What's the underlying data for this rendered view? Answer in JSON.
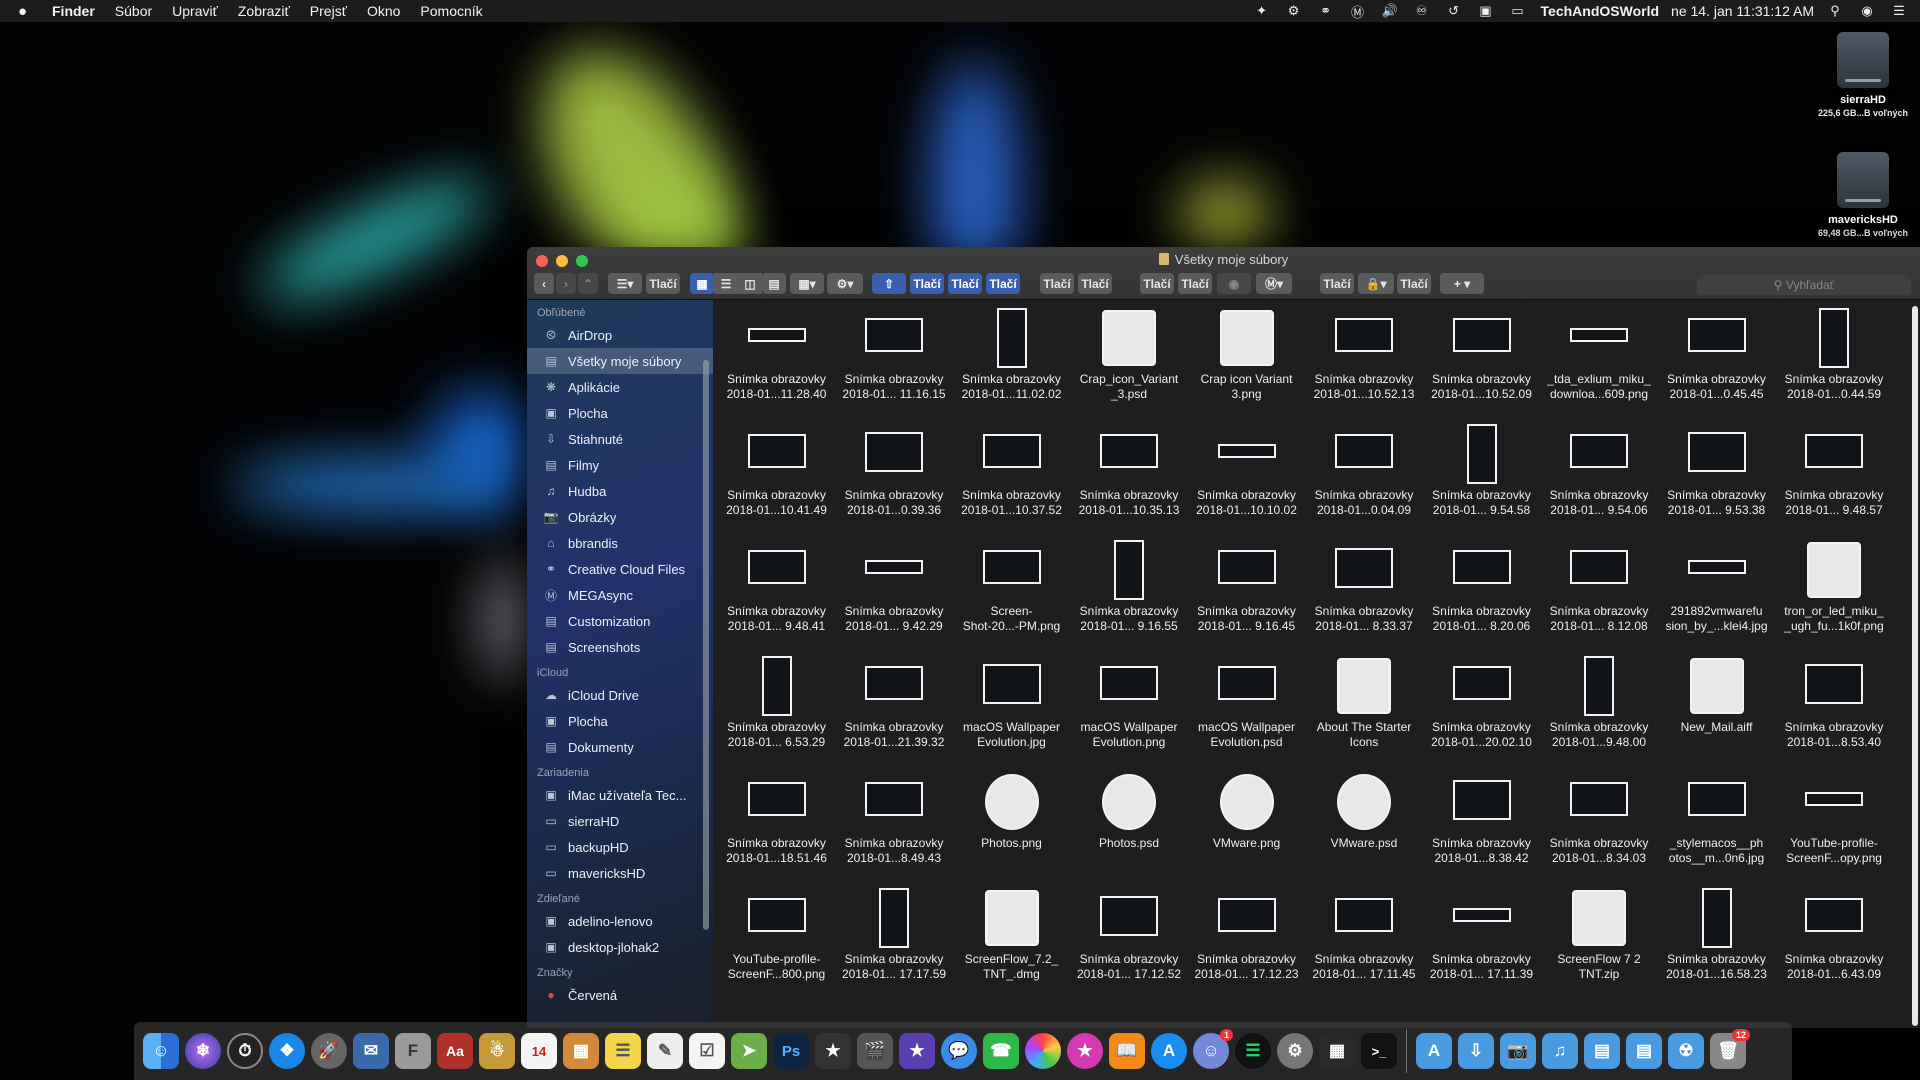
{
  "menubar": {
    "apple": "",
    "app": "Finder",
    "menus": [
      "Súbor",
      "Upraviť",
      "Zobraziť",
      "Prejsť",
      "Okno",
      "Pomocník"
    ],
    "user": "TechAndOSWorld",
    "clock": "ne 14. jan  11:31:12 AM"
  },
  "desktop": {
    "drives": [
      {
        "name": "sierraHD",
        "size": "225,6 GB...B voľných"
      },
      {
        "name": "mavericksHD",
        "size": "69,48 GB...B voľných"
      }
    ]
  },
  "window": {
    "title": "Všetky moje súbory",
    "toolbar_label": "Tlačí",
    "search_placeholder": "Vyhľadať"
  },
  "sidebar": {
    "sections": [
      {
        "title": "Obľúbené",
        "items": [
          {
            "label": "AirDrop",
            "icon": "airdrop-icon"
          },
          {
            "label": "Všetky moje súbory",
            "icon": "all-files-icon",
            "selected": true
          },
          {
            "label": "Aplikácie",
            "icon": "applications-icon"
          },
          {
            "label": "Plocha",
            "icon": "desktop-icon"
          },
          {
            "label": "Stiahnuté",
            "icon": "downloads-icon"
          },
          {
            "label": "Filmy",
            "icon": "movies-icon"
          },
          {
            "label": "Hudba",
            "icon": "music-icon"
          },
          {
            "label": "Obrázky",
            "icon": "pictures-icon"
          },
          {
            "label": "bbrandis",
            "icon": "home-icon"
          },
          {
            "label": "Creative Cloud Files",
            "icon": "creative-cloud-icon"
          },
          {
            "label": "MEGAsync",
            "icon": "mega-icon"
          },
          {
            "label": "Customization",
            "icon": "folder-icon"
          },
          {
            "label": "Screenshots",
            "icon": "folder-icon"
          }
        ]
      },
      {
        "title": "iCloud",
        "items": [
          {
            "label": "iCloud Drive",
            "icon": "icloud-icon"
          },
          {
            "label": "Plocha",
            "icon": "desktop-icon"
          },
          {
            "label": "Dokumenty",
            "icon": "documents-icon"
          }
        ]
      },
      {
        "title": "Zariadenia",
        "items": [
          {
            "label": "iMac užívateľa Tec...",
            "icon": "imac-icon"
          },
          {
            "label": "sierraHD",
            "icon": "disk-icon"
          },
          {
            "label": "backupHD",
            "icon": "disk-icon"
          },
          {
            "label": "mavericksHD",
            "icon": "disk-icon"
          }
        ]
      },
      {
        "title": "Zdieľané",
        "items": [
          {
            "label": "adelino-lenovo",
            "icon": "computer-icon"
          },
          {
            "label": "desktop-jlohak2",
            "icon": "computer-icon"
          }
        ]
      },
      {
        "title": "Značky",
        "items": [
          {
            "label": "Červená",
            "icon": "red-tag-icon"
          }
        ]
      }
    ]
  },
  "files": [
    [
      "Snímka obrazovky\n2018-01...11.28.40",
      "Snímka obrazovky\n2018-01... 11.16.15",
      "Snímka obrazovky\n2018-01...11.02.02",
      "Crap_icon_Variant\n_3.psd",
      "Crap icon Variant\n3.png",
      "Snímka obrazovky\n2018-01...10.52.13",
      "Snímka obrazovky\n2018-01...10.52.09",
      "_tda_exlium_miku_\ndownloa...609.png",
      "Snímka obrazovky\n2018-01...0.45.45",
      "Snímka obrazovky\n2018-01...0.44.59"
    ],
    [
      "Snímka obrazovky\n2018-01...10.41.49",
      "Snímka obrazovky\n2018-01...0.39.36",
      "Snímka obrazovky\n2018-01...10.37.52",
      "Snímka obrazovky\n2018-01...10.35.13",
      "Snímka obrazovky\n2018-01...10.10.02",
      "Snímka obrazovky\n2018-01...0.04.09",
      "Snímka obrazovky\n2018-01... 9.54.58",
      "Snímka obrazovky\n2018-01... 9.54.06",
      "Snímka obrazovky\n2018-01... 9.53.38",
      "Snímka obrazovky\n2018-01... 9.48.57"
    ],
    [
      "Snímka obrazovky\n2018-01... 9.48.41",
      "Snímka obrazovky\n2018-01... 9.42.29",
      "Screen-\nShot-20...-PM.png",
      "Snímka obrazovky\n2018-01... 9.16.55",
      "Snímka obrazovky\n2018-01... 9.16.45",
      "Snímka obrazovky\n2018-01... 8.33.37",
      "Snímka obrazovky\n2018-01... 8.20.06",
      "Snímka obrazovky\n2018-01... 8.12.08",
      "291892vmwarefu\nsion_by_...klei4.jpg",
      "tron_or_led_miku_\n_ugh_fu...1k0f.png"
    ],
    [
      "Snímka obrazovky\n2018-01... 6.53.29",
      "Snímka obrazovky\n2018-01...21.39.32",
      "macOS Wallpaper\nEvolution.jpg",
      "macOS Wallpaper\nEvolution.png",
      "macOS Wallpaper\nEvolution.psd",
      "About The Starter\nIcons",
      "Snímka obrazovky\n2018-01...20.02.10",
      "Snímka obrazovky\n2018-01...9.48.00",
      "New_Mail.aiff",
      "Snímka obrazovky\n2018-01...8.53.40"
    ],
    [
      "Snímka obrazovky\n2018-01...18.51.46",
      "Snímka obrazovky\n2018-01...8.49.43",
      "Photos.png",
      "Photos.psd",
      "VMware.png",
      "VMware.psd",
      "Snímka obrazovky\n2018-01...8.38.42",
      "Snímka obrazovky\n2018-01...8.34.03",
      "_stylemacos__ph\notos__m...0n6.jpg",
      "YouTube-profile-\nScreenF...opy.png"
    ],
    [
      "YouTube-profile-\nScreenF...800.png",
      "Snímka obrazovky\n2018-01... 17.17.59",
      "ScreenFlow_7.2_\nTNT_.dmg",
      "Snímka obrazovky\n2018-01... 17.12.52",
      "Snímka obrazovky\n2018-01... 17.12.23",
      "Snímka obrazovky\n2018-01... 17.11.45",
      "Snímka obrazovky\n2018-01... 17.11.39",
      "ScreenFlow 7 2\nTNT.zip",
      "Snímka obrazovky\n2018-01...16.58.23",
      "Snímka obrazovky\n2018-01...6.43.09"
    ]
  ],
  "dock": {
    "badges": {
      "discord": "1",
      "trash": "12"
    }
  }
}
